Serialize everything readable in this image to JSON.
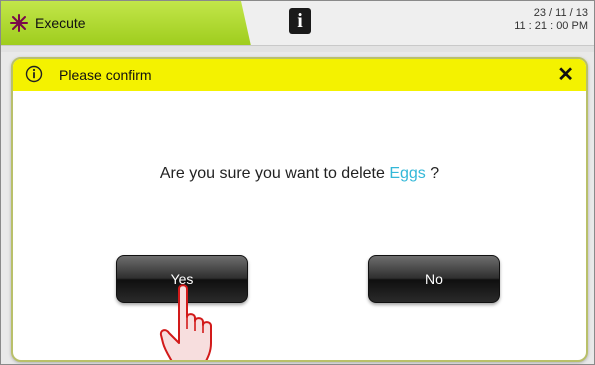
{
  "topbar": {
    "mode_label": "Execute",
    "mode_icon": "spark-icon",
    "info_glyph": "i",
    "date": "23 / 11 / 13",
    "time": "11 : 21 : 00 PM"
  },
  "dialog": {
    "title": "Please confirm",
    "close_glyph": "✕",
    "message_prefix": "Are you sure you want to delete ",
    "item_name": "Eggs",
    "message_suffix": " ?",
    "yes_label": "Yes",
    "no_label": "No"
  },
  "colors": {
    "mode_tab": "#a6d12a",
    "dialog_header": "#f4f200",
    "item_highlight": "#33b8d8",
    "button": "#1f1f1f"
  }
}
